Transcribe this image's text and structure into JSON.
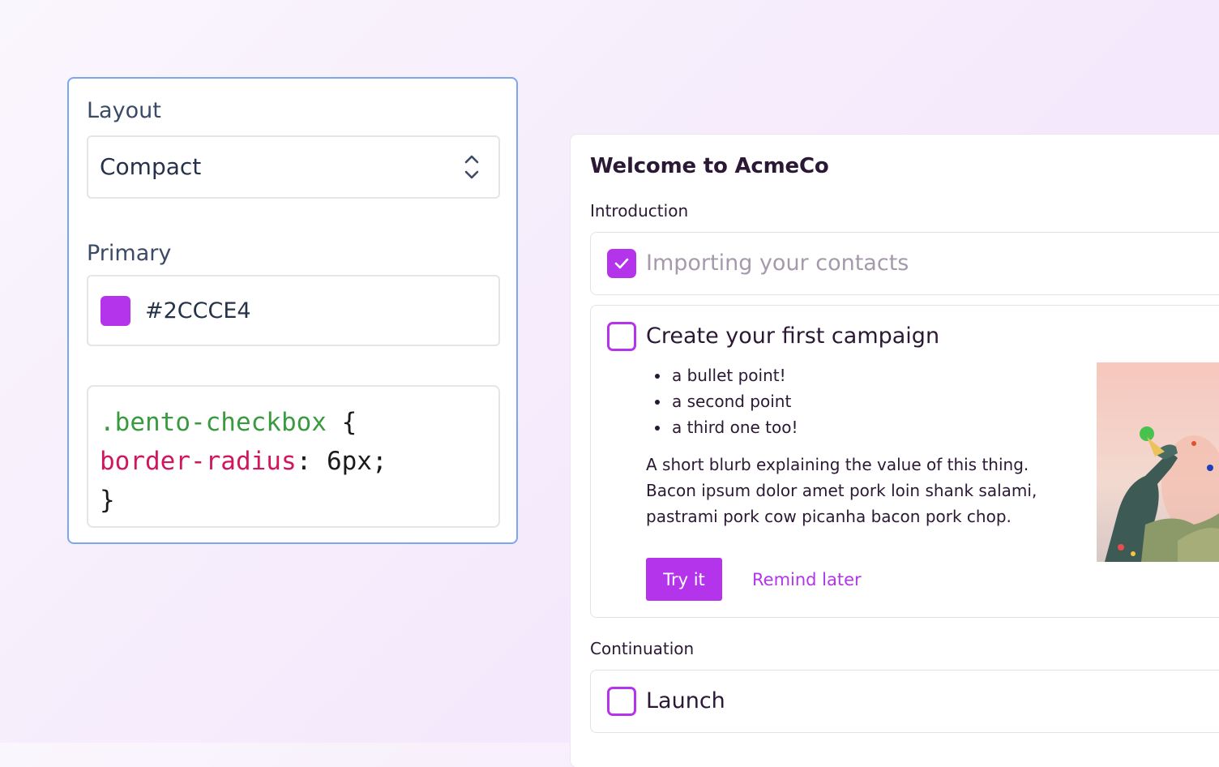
{
  "settings": {
    "layout_label": "Layout",
    "layout_value": "Compact",
    "primary_label": "Primary",
    "primary_hex": "#2CCCE4",
    "swatch_color": "#b434ec",
    "code": {
      "selector": ".bento-checkbox",
      "open_brace": " {",
      "property": "border-radius",
      "value": ": 6px;",
      "close_brace": "}"
    }
  },
  "checklist": {
    "title": "Welcome to AcmeCo",
    "sections": [
      {
        "label": "Introduction"
      },
      {
        "label": "Continuation"
      }
    ],
    "tasks": [
      {
        "title": "Importing your contacts",
        "checked": true
      },
      {
        "title": "Create your first campaign",
        "checked": false,
        "bullets": [
          "a bullet point!",
          "a second point",
          "a third one too!"
        ],
        "blurb": "A short blurb explaining the value of this thing. Bacon ipsum dolor amet pork loin shank salami, pastrami pork cow picanha bacon pork chop.",
        "primary_action": "Try it",
        "secondary_action": "Remind later"
      },
      {
        "title": "Launch",
        "checked": false
      }
    ],
    "accent_color": "#b434ec"
  }
}
